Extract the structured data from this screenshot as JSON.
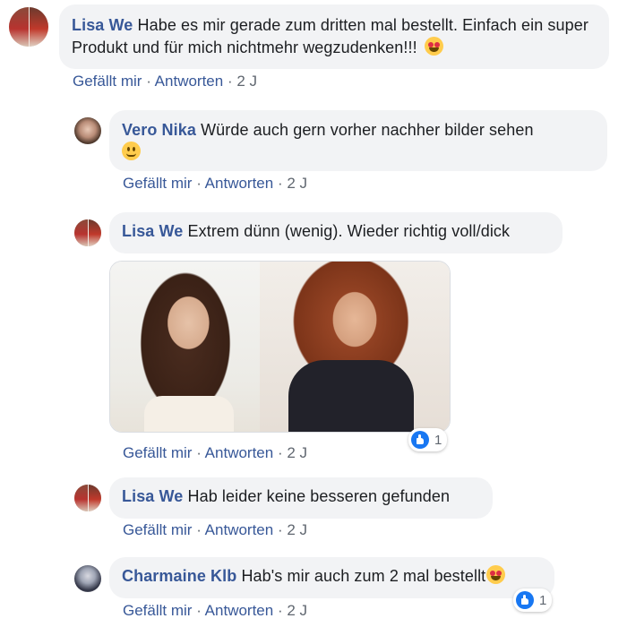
{
  "comments": [
    {
      "author": "Lisa We",
      "text": "Habe es mir gerade zum dritten mal bestellt. Einfach ein super Produkt und für mich nichtmehr wegzudenken!!!",
      "emoji": "heart-eyes-emoji",
      "like_label": "Gefällt mir",
      "reply_label": "Antworten",
      "time": "2 J"
    },
    {
      "author": "Vero Nika",
      "text": "Würde auch gern vorher nachher bilder sehen",
      "emoji": "smiling-emoji",
      "like_label": "Gefällt mir",
      "reply_label": "Antworten",
      "time": "2 J"
    },
    {
      "author": "Lisa We",
      "text": "Extrem dünn (wenig). Wieder richtig voll/dick",
      "attachment": "photo-before-after",
      "reaction_count": "1",
      "like_label": "Gefällt mir",
      "reply_label": "Antworten",
      "time": "2 J"
    },
    {
      "author": "Lisa We",
      "text": "Hab leider keine besseren gefunden",
      "like_label": "Gefällt mir",
      "reply_label": "Antworten",
      "time": "2 J"
    },
    {
      "author": "Charmaine Klb",
      "text": "Hab's mir auch zum 2 mal bestellt",
      "emoji": "heart-eyes-emoji",
      "reaction_count": "1",
      "like_label": "Gefällt mir",
      "reply_label": "Antworten",
      "time": "2 J"
    }
  ],
  "separator": "·",
  "colors": {
    "name": "#385898",
    "bubble": "#f2f3f5",
    "meta": "#606770",
    "like": "#1877f2"
  }
}
